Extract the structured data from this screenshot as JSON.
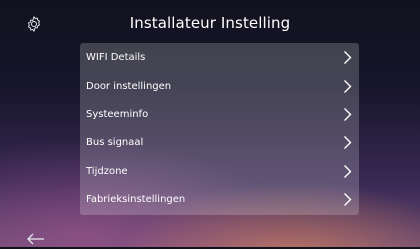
{
  "header": {
    "title": "Installateur Instelling",
    "settings_icon": "gear-icon"
  },
  "menu": {
    "items": [
      {
        "label": "WIFI Details",
        "icon": "chevron-right-icon"
      },
      {
        "label": "Door instellingen",
        "icon": "chevron-right-icon"
      },
      {
        "label": "Systeeminfo",
        "icon": "chevron-right-icon"
      },
      {
        "label": "Bus signaal",
        "icon": "chevron-right-icon"
      },
      {
        "label": "Tijdzone",
        "icon": "chevron-right-icon"
      },
      {
        "label": "Fabrieksinstellingen",
        "icon": "chevron-right-icon"
      }
    ]
  },
  "footer": {
    "back_icon": "arrow-left-icon"
  },
  "colors": {
    "text": "#ffffff",
    "panel": "rgba(255,255,255,0.20)",
    "background_top": "#12121f",
    "background_bottom": "#6a4a72"
  }
}
